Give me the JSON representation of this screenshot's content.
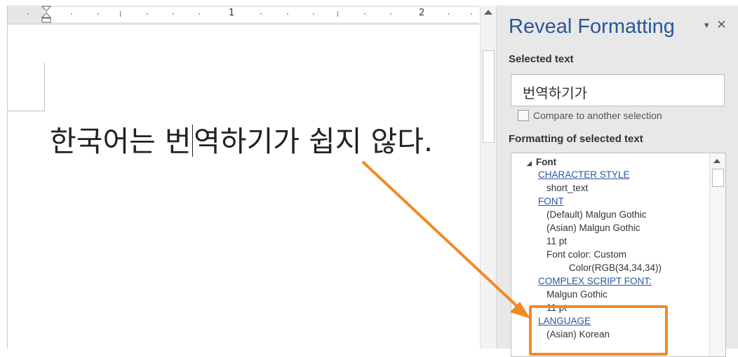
{
  "document": {
    "ruler_numbers": [
      "1",
      "2"
    ],
    "text_before_caret": "한국어는 번",
    "text_after_caret": "역하기가 쉽지 않다."
  },
  "panel": {
    "title": "Reveal Formatting",
    "menu_icon": "dropdown-triangle-icon",
    "close_icon": "close-icon",
    "close_glyph": "×",
    "menu_glyph": "▾",
    "selected_text_heading": "Selected text",
    "selected_text_value": "번역하기가",
    "compare_label": "Compare to another selection",
    "formatting_heading": "Formatting of selected text",
    "tree": {
      "expander": "◢",
      "font_heading": "Font",
      "character_style_link": "CHARACTER STYLE",
      "character_style_value": "short_text",
      "font_link": "FONT",
      "font_default": "(Default) Malgun Gothic",
      "font_asian": "(Asian) Malgun Gothic",
      "font_size": "11 pt",
      "font_color": "Font color: Custom",
      "font_color_value": "Color(RGB(34,34,34))",
      "complex_script_link": "COMPLEX SCRIPT FONT:",
      "complex_script_font": "Malgun Gothic",
      "complex_script_size": "11 pt",
      "language_link": "LANGUAGE",
      "language_value": "(Asian) Korean"
    }
  },
  "colors": {
    "accent": "#2b579a",
    "highlight": "#f08a24"
  }
}
